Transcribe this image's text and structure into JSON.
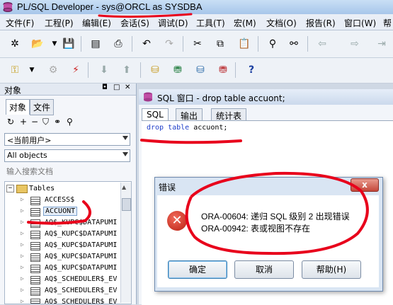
{
  "window": {
    "app_name": "PL/SQL Developer",
    "separator": " - ",
    "connection": "sys@ORCL as SYSDBA"
  },
  "menu": [
    "文件(F)",
    "工程(P)",
    "编辑(E)",
    "会话(S)",
    "调试(D)",
    "工具(T)",
    "宏(M)",
    "文档(O)",
    "报告(R)",
    "窗口(W)",
    "帮"
  ],
  "left_panel": {
    "title": "对象",
    "tabs": [
      "对象",
      "文件"
    ],
    "user_combo": "<当前用户>",
    "objects_combo": "All objects",
    "search_placeholder": "输入搜索文档",
    "tree": {
      "folder": "Tables",
      "items": [
        "ACCESS$",
        "ACCUONT",
        "AQ$_KUPC$DATAPUMI",
        "AQ$_KUPC$DATAPUMI",
        "AQ$_KUPC$DATAPUMI",
        "AQ$_KUPC$DATAPUMI",
        "AQ$_KUPC$DATAPUMI",
        "AQ$_SCHEDULER$_EV",
        "AQ$_SCHEDULER$_EV",
        "AQ$_SCHEDULER$_EV"
      ]
    }
  },
  "sql_window": {
    "title": "SQL 窗口 - drop table accuont;",
    "tabs": [
      "SQL",
      "输出",
      "统计表"
    ],
    "code_keyword": "drop table",
    "code_rest": " accuont;"
  },
  "error_dialog": {
    "title": "错误",
    "close": "x",
    "icon": "error-x-icon",
    "lines": [
      "ORA-00604: 递归 SQL 级别 2 出现错误",
      "ORA-00942: 表或视图不存在"
    ],
    "buttons": [
      "确定",
      "取消",
      "帮助(H)"
    ]
  },
  "colors": {
    "annotation_red": "#e8001b",
    "keyword_blue": "#1f3ec9"
  }
}
